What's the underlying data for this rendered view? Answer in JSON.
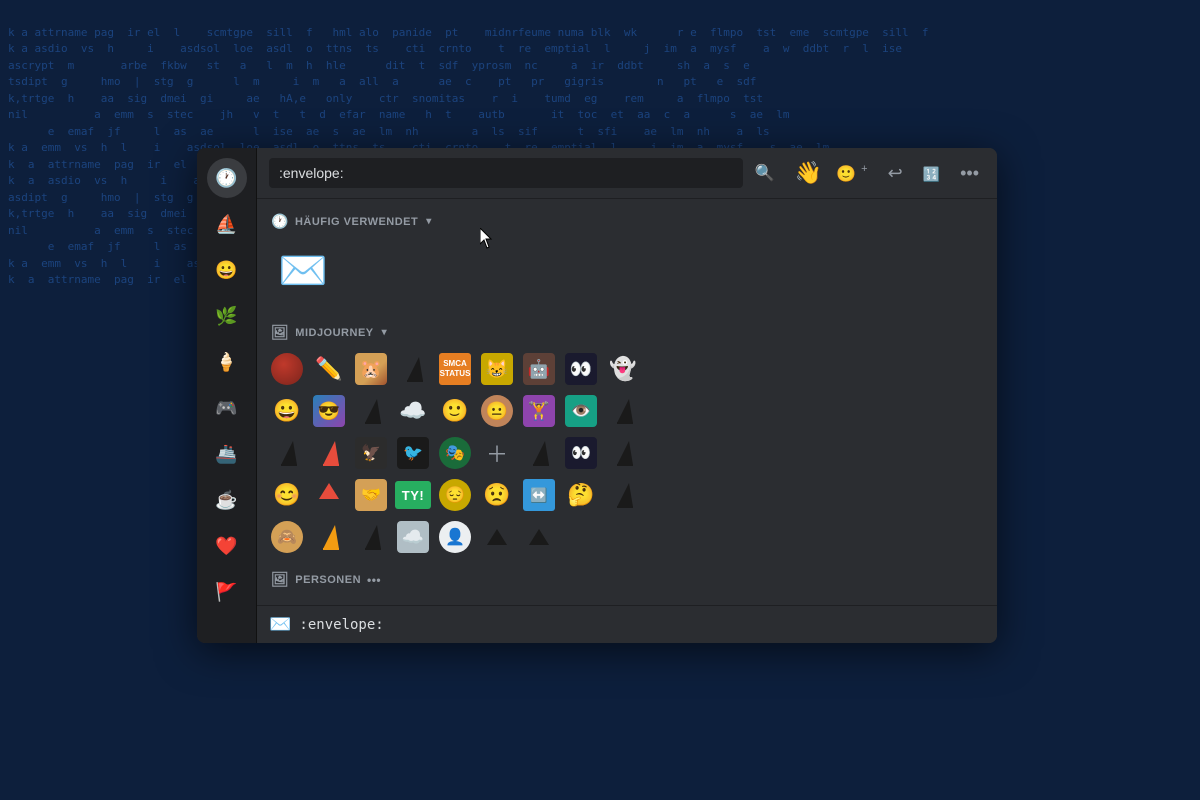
{
  "terminal": {
    "lines": "k a attrname pag  ir el  l    scmtgpe  sill  f   hml alo  panide  pt    midnrfeume numa blk  wk\nk a asdio  vs  h     i    asdsol  loe  asdl  o  ttns  ts    cti  crnto    t  re  emptial  l     j  im  a  mysf\nascrypt  m       arbe  fkbw   st   a   l  m  h  hle            dit  t  sdf  yprosm  nc     a  ir  ddbt\ntsdipt  g     hmo  |  stg  g      l  m     i  m   a  all  a      ae  c    pt   pr   gigris        n\nk,trtge  h    aa  sig  dmei  gi     ae   hA,e   only    ctr  snomitas    r  i    tumd  eg    rem\nnil          a  emm  s  stec    jh   v  t   t  d  efar  name   h  t    autb       it  toc  et  aa  c  a\n      e  emaf  jf     l  as  ae      l  ise  ae  s  ae  lm  nh        a  ls  sif      t  sfi\nk a  emm  vs  h  l    i    asdsol  loe  asdl  o  ttns  ts    cti  crnto    t  re  emptial  l     j  im  a  mysf\nk  a  attrname  pag  ir  el  l    scmtgpe  sill  f   hml  alo  panide  pt    midnrfeume\nk  a  asdio  vs  h     i    asdsol  loe  asdl  o  ttns  ts    cti  crnto\nasdipt  g     hmo  |  stg  g      l  m     i  m   a  all  a      ae  c    pt   pr   gigris\nk,trtge  h    aa  sig  dmei  gi     ae   hA,e   only    ctr  snomitas    r  i    tumd  eg    rem\nnil          a  emm  s  stec    jh   v  t   t  d  efar  name   h  t    autb       it  toc  et  aa  c  a\n      e  emaf  jf     l  as  ae      l  ise  ae  s  ae  lm  nh        a  ls  sif      t  sfi",
    "bg_color": "#0d1f3c",
    "text_color": "#1e4a8a"
  },
  "sidebar": {
    "icons": [
      {
        "name": "clock-icon",
        "symbol": "🕐",
        "label": "Recent"
      },
      {
        "name": "sailboat-icon",
        "symbol": "⛵",
        "label": "Midjourney"
      },
      {
        "name": "smiley-icon",
        "symbol": "😀",
        "label": "Smileys"
      },
      {
        "name": "leaf-icon",
        "symbol": "🌿",
        "label": "Nature"
      },
      {
        "name": "popsicle-icon",
        "symbol": "🍦",
        "label": "Food"
      },
      {
        "name": "gamepad-icon",
        "symbol": "🎮",
        "label": "Activities"
      },
      {
        "name": "submarine-icon",
        "symbol": "🚢",
        "label": "Travel"
      },
      {
        "name": "coffee-icon",
        "symbol": "☕",
        "label": "Objects"
      },
      {
        "name": "heart-icon",
        "symbol": "❤️",
        "label": "Symbols"
      },
      {
        "name": "flag-icon",
        "symbol": "🚩",
        "label": "Flags"
      }
    ]
  },
  "header": {
    "search_placeholder": ":envelope:",
    "search_value": ":envelope:",
    "waving_hand": "👋",
    "action_icons": [
      {
        "name": "add-emoji-icon",
        "symbol": "😊+",
        "label": "Add Emoji"
      },
      {
        "name": "reply-icon",
        "symbol": "↩",
        "label": "Reply"
      },
      {
        "name": "nitro-icon",
        "symbol": "#",
        "label": "Nitro"
      },
      {
        "name": "more-icon",
        "symbol": "•••",
        "label": "More"
      }
    ]
  },
  "sections": [
    {
      "id": "haeufig",
      "label": "HÄUFIG VERWENDET",
      "icon": "🕐",
      "collapsed": false,
      "emojis": [
        {
          "id": "envelope",
          "display": "✉️",
          "type": "unicode",
          "label": "envelope"
        }
      ]
    },
    {
      "id": "midjourney",
      "label": "MIDJOURNEY",
      "icon": "🖼",
      "collapsed": false,
      "emojis": [
        {
          "id": "mj1",
          "display": "🍊",
          "type": "custom-ball",
          "label": "orange ball",
          "bg": "#c0392b",
          "text": ""
        },
        {
          "id": "mj2",
          "display": "✏️",
          "type": "unicode",
          "label": "pencil"
        },
        {
          "id": "mj3",
          "display": "🐹",
          "type": "custom",
          "label": "hamster",
          "bg": "#d4a056"
        },
        {
          "id": "mj4",
          "display": "⛵",
          "type": "sail",
          "label": "sail"
        },
        {
          "id": "mj5",
          "display": "📊",
          "type": "custom",
          "label": "status",
          "bg": "#e67e22"
        },
        {
          "id": "mj6",
          "display": "😸",
          "type": "custom",
          "label": "cat face",
          "bg": "#c8a800"
        },
        {
          "id": "mj7",
          "display": "🤖",
          "type": "custom",
          "label": "robot",
          "bg": "#5d4037"
        },
        {
          "id": "mj8",
          "display": "👀",
          "type": "custom",
          "label": "eyes",
          "bg": "#1a1a2e"
        },
        {
          "id": "mj9",
          "display": "👻",
          "type": "unicode",
          "label": "ghost"
        },
        {
          "id": "mj10",
          "display": "😊",
          "type": "unicode",
          "label": "happy"
        },
        {
          "id": "mj11",
          "display": "😎",
          "type": "custom",
          "label": "cool",
          "bg": "#2980b9"
        },
        {
          "id": "mj12",
          "display": "⛵",
          "type": "sail",
          "label": "sail2"
        },
        {
          "id": "mj13",
          "display": "☁️",
          "type": "unicode",
          "label": "cloud"
        },
        {
          "id": "mj14",
          "display": "🙂",
          "type": "unicode",
          "label": "slight smile"
        },
        {
          "id": "mj15",
          "display": "😐",
          "type": "custom",
          "label": "neutral",
          "bg": "#f5c518"
        },
        {
          "id": "mj16",
          "display": "🏋️",
          "type": "custom",
          "label": "lift",
          "bg": "#8e44ad"
        },
        {
          "id": "mj17",
          "display": "👁️",
          "type": "custom",
          "label": "eye",
          "bg": "#16a085"
        },
        {
          "id": "mj18",
          "display": "⛵",
          "type": "sail",
          "label": "sail3"
        },
        {
          "id": "mj19",
          "display": "⛵",
          "type": "sail",
          "label": "sail4"
        },
        {
          "id": "mj20",
          "display": "⛵",
          "type": "sail",
          "label": "sail5"
        },
        {
          "id": "mj21",
          "display": "🦅",
          "type": "custom",
          "label": "bird",
          "bg": "#2c2c2c"
        },
        {
          "id": "mj22",
          "display": "🐦",
          "type": "custom",
          "label": "raven",
          "bg": "#1a1a1a"
        },
        {
          "id": "mj23",
          "display": "🎭",
          "type": "custom",
          "label": "mask",
          "bg": "#1a6b3a"
        },
        {
          "id": "mj24",
          "display": "➕",
          "type": "plus",
          "label": "add"
        },
        {
          "id": "mj25",
          "display": "⛵",
          "type": "sail",
          "label": "sail6"
        },
        {
          "id": "mj26",
          "display": "👀",
          "type": "custom",
          "label": "eyes2",
          "bg": "#1a1a2e"
        },
        {
          "id": "mj27",
          "display": "⛵",
          "type": "sail",
          "label": "sail7"
        },
        {
          "id": "mj28",
          "display": "😊",
          "type": "custom",
          "label": "happy2",
          "bg": "#f39c12"
        },
        {
          "id": "mj29",
          "display": "🏹",
          "type": "custom-arrow",
          "label": "arrow",
          "bg": "#e74c3c"
        },
        {
          "id": "mj30",
          "display": "🤝",
          "type": "custom",
          "label": "hand",
          "bg": "#d4a056"
        },
        {
          "id": "mj31",
          "display": "TY!",
          "type": "text",
          "label": "ty",
          "bg": "#27ae60",
          "text": "TY!"
        },
        {
          "id": "mj32",
          "display": "😐",
          "type": "custom",
          "label": "face",
          "bg": "#c8a800"
        },
        {
          "id": "mj33",
          "display": "😟",
          "type": "unicode",
          "label": "worried"
        },
        {
          "id": "mj34",
          "display": "↔️",
          "type": "custom",
          "label": "expand",
          "bg": "#3498db"
        },
        {
          "id": "mj35",
          "display": "🤔",
          "type": "unicode",
          "label": "thinking"
        },
        {
          "id": "mj36",
          "display": "⛵",
          "type": "sail",
          "label": "sail8"
        },
        {
          "id": "mj37",
          "display": "🙈",
          "type": "custom",
          "label": "monkey",
          "bg": "#d4a056"
        },
        {
          "id": "mj38",
          "display": "⛵",
          "type": "sail",
          "label": "sail9"
        },
        {
          "id": "mj39",
          "display": "⛵",
          "type": "sail",
          "label": "sail10"
        },
        {
          "id": "mj40",
          "display": "☁️",
          "type": "unicode",
          "label": "cloud2"
        },
        {
          "id": "mj41",
          "display": "👤",
          "type": "custom",
          "label": "ghost2",
          "bg": "#b0bec5"
        },
        {
          "id": "mj42",
          "display": "▲",
          "type": "sail-small",
          "label": "sail11"
        },
        {
          "id": "mj43",
          "display": "▲",
          "type": "sail-small",
          "label": "sail12"
        }
      ]
    }
  ],
  "footer": {
    "icon": "✉️",
    "text": ":envelope:"
  },
  "colors": {
    "bg_modal": "#2b2d31",
    "bg_sidebar": "#1e1f22",
    "bg_search": "#1e1f22",
    "text_primary": "#dbdee1",
    "text_muted": "#949ba4",
    "border": "#1e1f22",
    "hover": "#3a3c40"
  }
}
